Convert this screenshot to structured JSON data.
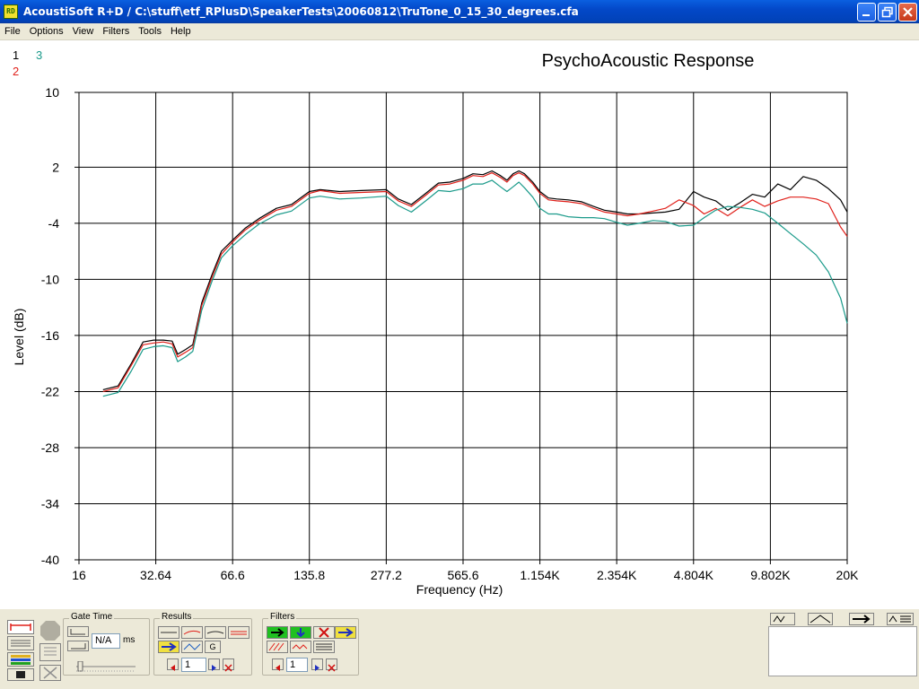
{
  "window": {
    "app_icon": "RD",
    "title": "AcoustiSoft R+D / C:\\stuff\\etf_RPlusD\\SpeakerTests\\20060812\\TruTone_0_15_30_degrees.cfa"
  },
  "menu": [
    "File",
    "Options",
    "View",
    "Filters",
    "Tools",
    "Help"
  ],
  "trace_keys": [
    {
      "label": "1",
      "color": "#000000"
    },
    {
      "label": "2",
      "color": "#e0201a"
    },
    {
      "label": "3",
      "color": "#1a9a8a"
    }
  ],
  "toolbar": {
    "gate_time": {
      "label": "Gate Time",
      "value": "N/A",
      "unit": "ms"
    },
    "results": {
      "label": "Results",
      "index": "1",
      "g_label": "G"
    },
    "filters": {
      "label": "Filters",
      "index": "1"
    }
  },
  "chart_data": {
    "type": "line",
    "title": "PsychoAcoustic Response",
    "xlabel": "Frequency (Hz)",
    "ylabel": "Level (dB)",
    "x_scale": "log",
    "xlim": [
      16,
      20000
    ],
    "ylim": [
      -40,
      10
    ],
    "x_ticks": [
      16,
      32.64,
      66.6,
      135.8,
      277.2,
      565.6,
      1154,
      2354,
      4804,
      9802,
      20000
    ],
    "x_tick_labels": [
      "16",
      "32.64",
      "66.6",
      "135.8",
      "277.2",
      "565.6",
      "1.154K",
      "2.354K",
      "4.804K",
      "9.802K",
      "20K"
    ],
    "y_ticks": [
      10,
      2,
      -4,
      -10,
      -16,
      -22,
      -28,
      -34,
      -40
    ],
    "grid": true,
    "series": [
      {
        "name": "1",
        "color": "#000000",
        "x": [
          20,
          23,
          26,
          29,
          32,
          35,
          38,
          40,
          43,
          46,
          50,
          55,
          60,
          66.6,
          75,
          85,
          100,
          115,
          135.8,
          150,
          180,
          220,
          277.2,
          310,
          350,
          400,
          450,
          500,
          565.6,
          620,
          680,
          740,
          800,
          850,
          900,
          950,
          1000,
          1080,
          1154,
          1250,
          1350,
          1500,
          1700,
          1900,
          2100,
          2354,
          2600,
          2900,
          3300,
          3700,
          4200,
          4804,
          5300,
          5900,
          6600,
          7400,
          8300,
          9300,
          10500,
          11800,
          13300,
          15000,
          16800,
          18800,
          20000
        ],
        "y": [
          -21.8,
          -21.4,
          -19.0,
          -16.7,
          -16.5,
          -16.5,
          -16.6,
          -18.0,
          -17.5,
          -17.0,
          -12.5,
          -9.5,
          -7.0,
          -5.8,
          -4.5,
          -3.5,
          -2.4,
          -2.0,
          -0.6,
          -0.4,
          -0.6,
          -0.5,
          -0.4,
          -1.4,
          -2.0,
          -0.8,
          0.3,
          0.4,
          0.8,
          1.3,
          1.2,
          1.6,
          1.1,
          0.6,
          1.3,
          1.6,
          1.3,
          0.4,
          -0.6,
          -1.3,
          -1.4,
          -1.5,
          -1.7,
          -2.2,
          -2.6,
          -2.8,
          -3.0,
          -3.0,
          -2.9,
          -2.8,
          -2.5,
          -0.6,
          -1.2,
          -1.6,
          -2.6,
          -1.8,
          -0.9,
          -1.2,
          0.2,
          -0.4,
          1.0,
          0.6,
          -0.3,
          -1.5,
          -2.8
        ]
      },
      {
        "name": "2",
        "color": "#e0201a",
        "x": [
          20,
          23,
          26,
          29,
          32,
          35,
          38,
          40,
          43,
          46,
          50,
          55,
          60,
          66.6,
          75,
          85,
          100,
          115,
          135.8,
          150,
          180,
          220,
          277.2,
          310,
          350,
          400,
          450,
          500,
          565.6,
          620,
          680,
          740,
          800,
          850,
          900,
          950,
          1000,
          1080,
          1154,
          1250,
          1350,
          1500,
          1700,
          1900,
          2100,
          2354,
          2600,
          2900,
          3300,
          3700,
          4200,
          4804,
          5300,
          5900,
          6600,
          7400,
          8300,
          9300,
          10500,
          11800,
          13300,
          15000,
          16800,
          18800,
          20000
        ],
        "y": [
          -22.0,
          -21.6,
          -19.2,
          -17.0,
          -16.8,
          -16.7,
          -16.9,
          -18.3,
          -17.8,
          -17.3,
          -12.8,
          -9.8,
          -7.3,
          -6.0,
          -4.7,
          -3.7,
          -2.6,
          -2.2,
          -0.8,
          -0.5,
          -0.8,
          -0.7,
          -0.6,
          -1.6,
          -2.2,
          -1.0,
          0.1,
          0.2,
          0.6,
          1.1,
          1.0,
          1.4,
          0.9,
          0.4,
          1.1,
          1.4,
          1.1,
          0.2,
          -0.8,
          -1.5,
          -1.6,
          -1.7,
          -1.9,
          -2.4,
          -2.8,
          -3.0,
          -3.2,
          -3.0,
          -2.7,
          -2.4,
          -1.5,
          -2.1,
          -3.0,
          -2.4,
          -3.2,
          -2.3,
          -1.5,
          -2.2,
          -1.6,
          -1.2,
          -1.2,
          -1.4,
          -1.9,
          -4.4,
          -5.4
        ]
      },
      {
        "name": "3",
        "color": "#1a9a8a",
        "x": [
          20,
          23,
          26,
          29,
          32,
          35,
          38,
          40,
          43,
          46,
          50,
          55,
          60,
          66.6,
          75,
          85,
          100,
          115,
          135.8,
          150,
          180,
          220,
          277.2,
          310,
          350,
          400,
          450,
          500,
          565.6,
          620,
          680,
          740,
          800,
          850,
          900,
          950,
          1000,
          1080,
          1154,
          1250,
          1350,
          1500,
          1700,
          1900,
          2100,
          2354,
          2600,
          2900,
          3300,
          3700,
          4200,
          4804,
          5300,
          5900,
          6600,
          7400,
          8300,
          9300,
          10500,
          11800,
          13300,
          15000,
          16800,
          18800,
          20000
        ],
        "y": [
          -22.5,
          -22.1,
          -19.8,
          -17.5,
          -17.2,
          -17.1,
          -17.3,
          -18.8,
          -18.3,
          -17.7,
          -13.3,
          -10.2,
          -7.7,
          -6.4,
          -5.2,
          -4.1,
          -3.1,
          -2.7,
          -1.3,
          -1.1,
          -1.4,
          -1.3,
          -1.1,
          -2.1,
          -2.8,
          -1.6,
          -0.5,
          -0.6,
          -0.3,
          0.2,
          0.2,
          0.6,
          -0.1,
          -0.6,
          -0.1,
          0.4,
          -0.2,
          -1.2,
          -2.4,
          -3.0,
          -3.0,
          -3.3,
          -3.4,
          -3.4,
          -3.5,
          -3.9,
          -4.2,
          -4.0,
          -3.7,
          -3.8,
          -4.3,
          -4.2,
          -3.4,
          -2.6,
          -2.2,
          -2.3,
          -2.5,
          -2.9,
          -4.0,
          -5.1,
          -6.2,
          -7.4,
          -9.2,
          -12.0,
          -14.7
        ]
      }
    ]
  }
}
